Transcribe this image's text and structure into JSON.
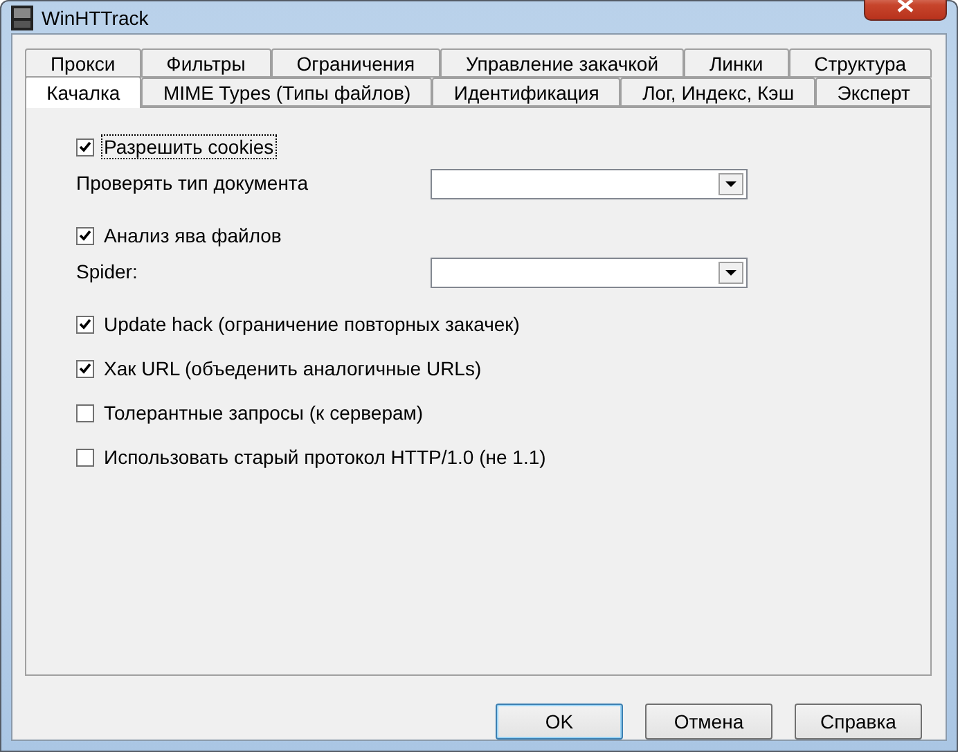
{
  "window": {
    "title": "WinHTTrack"
  },
  "tab_rows": [
    [
      {
        "label": "Прокси",
        "selected": false
      },
      {
        "label": "Фильтры",
        "selected": false
      },
      {
        "label": "Ограничения",
        "selected": false
      },
      {
        "label": "Управление закачкой",
        "selected": false
      },
      {
        "label": "Линки",
        "selected": false
      },
      {
        "label": "Структура",
        "selected": false
      }
    ],
    [
      {
        "label": "Качалка",
        "selected": true
      },
      {
        "label": "MIME Types (Типы файлов)",
        "selected": false
      },
      {
        "label": "Идентификация",
        "selected": false
      },
      {
        "label": "Лог, Индекс, Кэш",
        "selected": false
      },
      {
        "label": "Эксперт",
        "selected": false
      }
    ]
  ],
  "options": [
    {
      "kind": "checkbox",
      "label": "Разрешить cookies",
      "checked": true,
      "focused": true
    },
    {
      "kind": "combo",
      "label": "Проверять тип документа"
    },
    {
      "kind": "checkbox",
      "label": "Анализ ява файлов",
      "checked": true,
      "focused": false
    },
    {
      "kind": "combo",
      "label": "Spider:"
    },
    {
      "kind": "checkbox",
      "label": "Update hack (ограничение повторных закачек)",
      "checked": true,
      "focused": false
    },
    {
      "kind": "checkbox",
      "label": "Хак URL (объеденить аналогичные URLs)",
      "checked": true,
      "focused": false
    },
    {
      "kind": "checkbox",
      "label": "Толерантные запросы (к серверам)",
      "checked": false,
      "focused": false
    },
    {
      "kind": "checkbox",
      "label": "Использовать старый протокол HTTP/1.0 (не 1.1)",
      "checked": false,
      "focused": false
    }
  ],
  "buttons": [
    {
      "label": "OK",
      "default": true
    },
    {
      "label": "Отмена",
      "default": false
    },
    {
      "label": "Справка",
      "default": false
    }
  ]
}
